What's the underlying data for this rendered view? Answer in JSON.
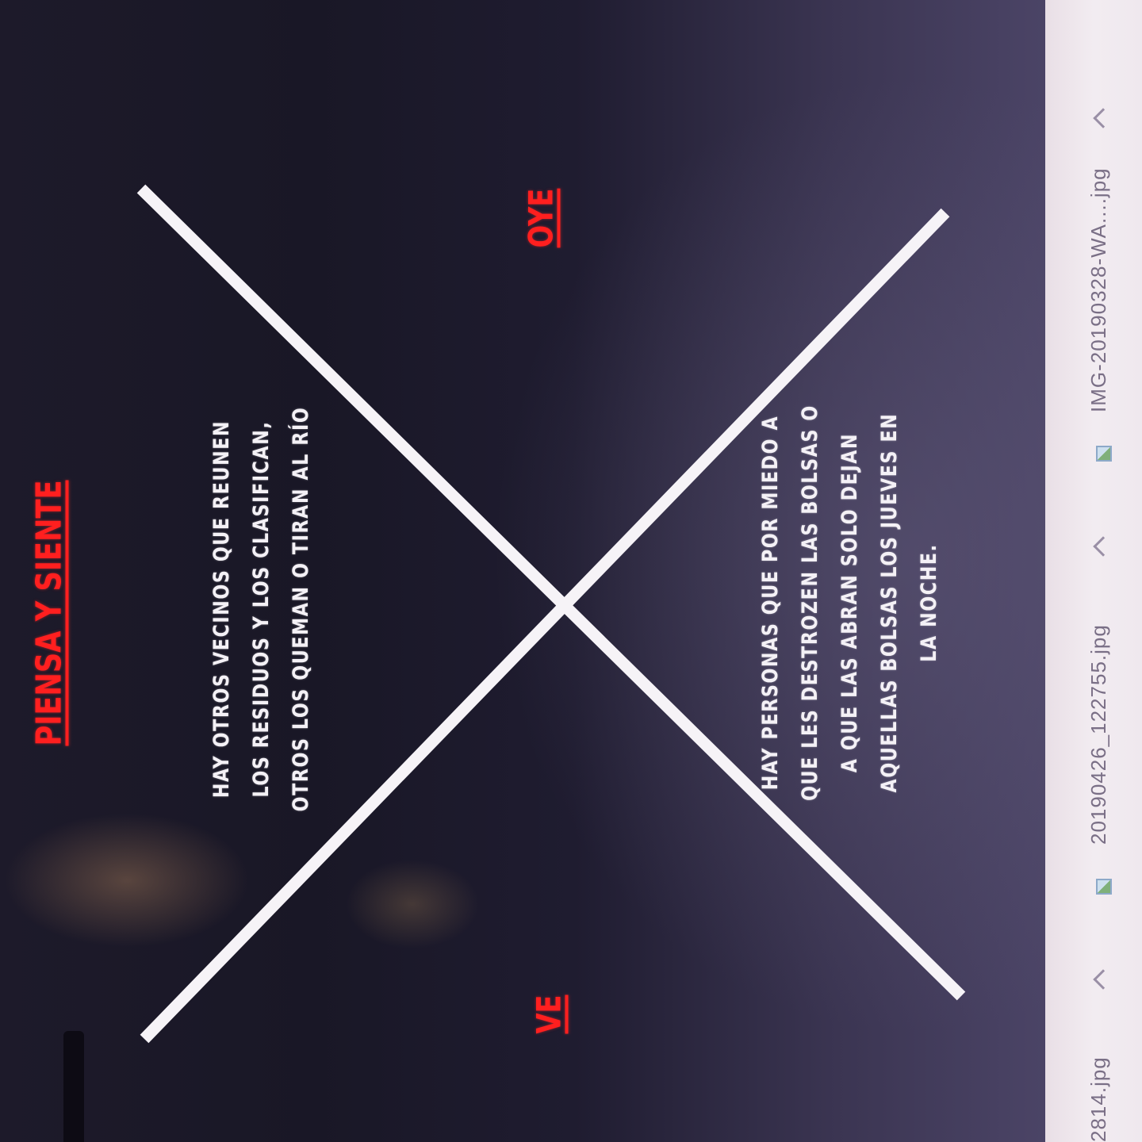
{
  "slide": {
    "title": "PIENSA Y SIENTE",
    "label_top": "OYE",
    "label_bottom": "VE",
    "text_left": [
      "HAY OTROS VECINOS QUE REUNEN",
      "LOS RESIDUOS Y LOS CLASIFICAN,",
      "OTROS LOS QUEMAN O TIRAN AL RÍO"
    ],
    "text_right": [
      "HAY PERSONAS QUE POR MIEDO A",
      "QUE LES DESTROZEN LAS BOLSAS O",
      "A QUE LAS ABRAN SOLO DEJAN",
      "AQUELLAS BOLSAS LOS JUEVES EN",
      "LA NOCHE."
    ],
    "colors": {
      "title_red": "#ff1f1f",
      "text_white": "#f4f1f6",
      "background": "#1d1a2a"
    }
  },
  "downloads_bar": {
    "items": [
      {
        "name": "2814.jpg",
        "icon": "image-file-icon"
      },
      {
        "name": "20190426_122755.jpg",
        "icon": "image-file-icon"
      },
      {
        "name": "IMG-20190328-WA....jpg",
        "icon": "image-file-icon"
      }
    ]
  }
}
